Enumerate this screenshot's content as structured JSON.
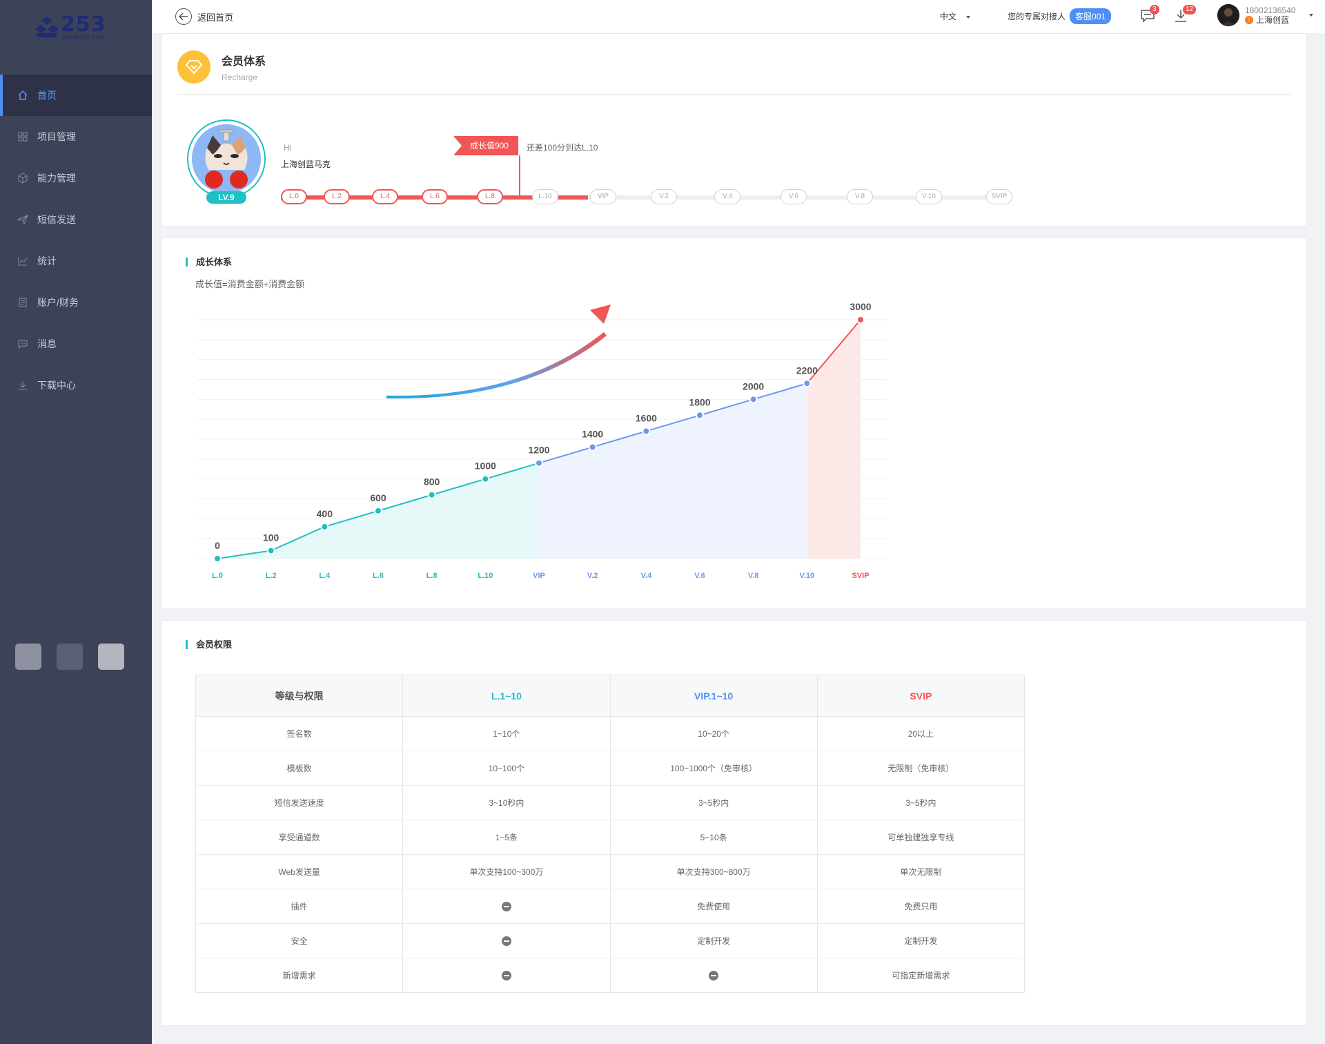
{
  "logo": {
    "text": "253",
    "url_text": "WWW.253.COM"
  },
  "sidebar": {
    "items": [
      {
        "label": "首页",
        "icon": "home-icon",
        "active": true
      },
      {
        "label": "项目管理",
        "icon": "grid-icon"
      },
      {
        "label": "能力管理",
        "icon": "cube-icon"
      },
      {
        "label": "短信发送",
        "icon": "send-icon"
      },
      {
        "label": "统计",
        "icon": "chart-icon"
      },
      {
        "label": "账户/财务",
        "icon": "document-icon"
      },
      {
        "label": "消息",
        "icon": "message-icon"
      },
      {
        "label": "下载中心",
        "icon": "download-icon"
      }
    ],
    "theme_swatches": [
      "#8e919f",
      "#5b6079",
      "#b3b5bf"
    ]
  },
  "header": {
    "back_label": "返回首页",
    "language": "中文",
    "contact_label": "您的专属对接人",
    "contact_name": "客服001",
    "message_count": "3",
    "download_count": "12",
    "user_phone": "18002136540",
    "user_company": "上海创蓝"
  },
  "membership": {
    "title": "会员体系",
    "subtitle": "Recharge",
    "greeting": "Hi",
    "company": "上海创蓝马克",
    "current_level_badge": "LV.9",
    "growth_flag": "成长值900",
    "to_next": "还差100分到达L.10",
    "levels_on": [
      "L.0",
      "L.2",
      "L.4",
      "L.6",
      "L.8"
    ],
    "levels_off": [
      "L.10",
      "VIP",
      "V.2",
      "V.4",
      "V.6",
      "V.8",
      "V.10",
      "SVIP"
    ],
    "progress_fraction": 0.42
  },
  "growth": {
    "section_title": "成长体系",
    "formula": "成长值=消费金额+消费金额"
  },
  "chart_data": {
    "type": "line",
    "title": "",
    "xlabel": "",
    "ylabel": "",
    "ylim": [
      0,
      3000
    ],
    "grid": true,
    "categories": [
      "L.0",
      "L.2",
      "L.4",
      "L.6",
      "L.8",
      "L.10",
      "VIP",
      "V.2",
      "V.4",
      "V.6",
      "V.8",
      "V.10",
      "SVIP"
    ],
    "values": [
      0,
      100,
      400,
      600,
      800,
      1000,
      1200,
      1400,
      1600,
      1800,
      2000,
      2200,
      3000
    ],
    "colors": {
      "L": "#1fbfc4",
      "VIP": "#6a98f0",
      "SVIP": "#f25555"
    }
  },
  "permissions": {
    "section_title": "会员权限",
    "headers": [
      "等级与权限",
      "L.1~10",
      "VIP.1~10",
      "SVIP"
    ],
    "header_colors": [
      "#555555",
      "#1fbfc4",
      "#4d8ff5",
      "#f25555"
    ],
    "rows": [
      [
        "签名数",
        "1~10个",
        "10~20个",
        "20以上"
      ],
      [
        "模板数",
        "10~100个",
        "100~1000个（免审核）",
        "无限制（免审核）"
      ],
      [
        "短信发送速度",
        "3~10秒内",
        "3~5秒内",
        "3~5秒内"
      ],
      [
        "享受通道数",
        "1~5条",
        "5~10条",
        "可单独建独享专线"
      ],
      [
        "Web发送量",
        "单次支持100~300万",
        "单次支持300~800万",
        "单次无限制"
      ],
      [
        "插件",
        "—",
        "免费使用",
        "免费只用"
      ],
      [
        "安全",
        "—",
        "定制开发",
        "定制开发"
      ],
      [
        "新增需求",
        "—",
        "—",
        "可指定新增需求"
      ]
    ]
  }
}
